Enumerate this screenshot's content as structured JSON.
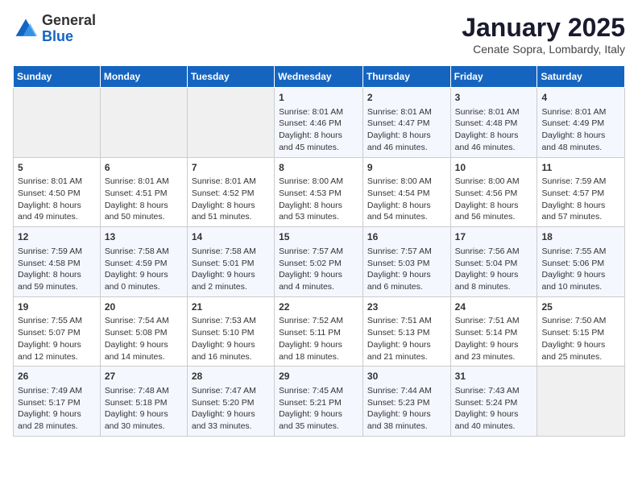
{
  "header": {
    "logo_general": "General",
    "logo_blue": "Blue",
    "month": "January 2025",
    "location": "Cenate Sopra, Lombardy, Italy"
  },
  "days_of_week": [
    "Sunday",
    "Monday",
    "Tuesday",
    "Wednesday",
    "Thursday",
    "Friday",
    "Saturday"
  ],
  "weeks": [
    [
      {
        "day": "",
        "info": ""
      },
      {
        "day": "",
        "info": ""
      },
      {
        "day": "",
        "info": ""
      },
      {
        "day": "1",
        "info": "Sunrise: 8:01 AM\nSunset: 4:46 PM\nDaylight: 8 hours and 45 minutes."
      },
      {
        "day": "2",
        "info": "Sunrise: 8:01 AM\nSunset: 4:47 PM\nDaylight: 8 hours and 46 minutes."
      },
      {
        "day": "3",
        "info": "Sunrise: 8:01 AM\nSunset: 4:48 PM\nDaylight: 8 hours and 46 minutes."
      },
      {
        "day": "4",
        "info": "Sunrise: 8:01 AM\nSunset: 4:49 PM\nDaylight: 8 hours and 48 minutes."
      }
    ],
    [
      {
        "day": "5",
        "info": "Sunrise: 8:01 AM\nSunset: 4:50 PM\nDaylight: 8 hours and 49 minutes."
      },
      {
        "day": "6",
        "info": "Sunrise: 8:01 AM\nSunset: 4:51 PM\nDaylight: 8 hours and 50 minutes."
      },
      {
        "day": "7",
        "info": "Sunrise: 8:01 AM\nSunset: 4:52 PM\nDaylight: 8 hours and 51 minutes."
      },
      {
        "day": "8",
        "info": "Sunrise: 8:00 AM\nSunset: 4:53 PM\nDaylight: 8 hours and 53 minutes."
      },
      {
        "day": "9",
        "info": "Sunrise: 8:00 AM\nSunset: 4:54 PM\nDaylight: 8 hours and 54 minutes."
      },
      {
        "day": "10",
        "info": "Sunrise: 8:00 AM\nSunset: 4:56 PM\nDaylight: 8 hours and 56 minutes."
      },
      {
        "day": "11",
        "info": "Sunrise: 7:59 AM\nSunset: 4:57 PM\nDaylight: 8 hours and 57 minutes."
      }
    ],
    [
      {
        "day": "12",
        "info": "Sunrise: 7:59 AM\nSunset: 4:58 PM\nDaylight: 8 hours and 59 minutes."
      },
      {
        "day": "13",
        "info": "Sunrise: 7:58 AM\nSunset: 4:59 PM\nDaylight: 9 hours and 0 minutes."
      },
      {
        "day": "14",
        "info": "Sunrise: 7:58 AM\nSunset: 5:01 PM\nDaylight: 9 hours and 2 minutes."
      },
      {
        "day": "15",
        "info": "Sunrise: 7:57 AM\nSunset: 5:02 PM\nDaylight: 9 hours and 4 minutes."
      },
      {
        "day": "16",
        "info": "Sunrise: 7:57 AM\nSunset: 5:03 PM\nDaylight: 9 hours and 6 minutes."
      },
      {
        "day": "17",
        "info": "Sunrise: 7:56 AM\nSunset: 5:04 PM\nDaylight: 9 hours and 8 minutes."
      },
      {
        "day": "18",
        "info": "Sunrise: 7:55 AM\nSunset: 5:06 PM\nDaylight: 9 hours and 10 minutes."
      }
    ],
    [
      {
        "day": "19",
        "info": "Sunrise: 7:55 AM\nSunset: 5:07 PM\nDaylight: 9 hours and 12 minutes."
      },
      {
        "day": "20",
        "info": "Sunrise: 7:54 AM\nSunset: 5:08 PM\nDaylight: 9 hours and 14 minutes."
      },
      {
        "day": "21",
        "info": "Sunrise: 7:53 AM\nSunset: 5:10 PM\nDaylight: 9 hours and 16 minutes."
      },
      {
        "day": "22",
        "info": "Sunrise: 7:52 AM\nSunset: 5:11 PM\nDaylight: 9 hours and 18 minutes."
      },
      {
        "day": "23",
        "info": "Sunrise: 7:51 AM\nSunset: 5:13 PM\nDaylight: 9 hours and 21 minutes."
      },
      {
        "day": "24",
        "info": "Sunrise: 7:51 AM\nSunset: 5:14 PM\nDaylight: 9 hours and 23 minutes."
      },
      {
        "day": "25",
        "info": "Sunrise: 7:50 AM\nSunset: 5:15 PM\nDaylight: 9 hours and 25 minutes."
      }
    ],
    [
      {
        "day": "26",
        "info": "Sunrise: 7:49 AM\nSunset: 5:17 PM\nDaylight: 9 hours and 28 minutes."
      },
      {
        "day": "27",
        "info": "Sunrise: 7:48 AM\nSunset: 5:18 PM\nDaylight: 9 hours and 30 minutes."
      },
      {
        "day": "28",
        "info": "Sunrise: 7:47 AM\nSunset: 5:20 PM\nDaylight: 9 hours and 33 minutes."
      },
      {
        "day": "29",
        "info": "Sunrise: 7:45 AM\nSunset: 5:21 PM\nDaylight: 9 hours and 35 minutes."
      },
      {
        "day": "30",
        "info": "Sunrise: 7:44 AM\nSunset: 5:23 PM\nDaylight: 9 hours and 38 minutes."
      },
      {
        "day": "31",
        "info": "Sunrise: 7:43 AM\nSunset: 5:24 PM\nDaylight: 9 hours and 40 minutes."
      },
      {
        "day": "",
        "info": ""
      }
    ]
  ]
}
